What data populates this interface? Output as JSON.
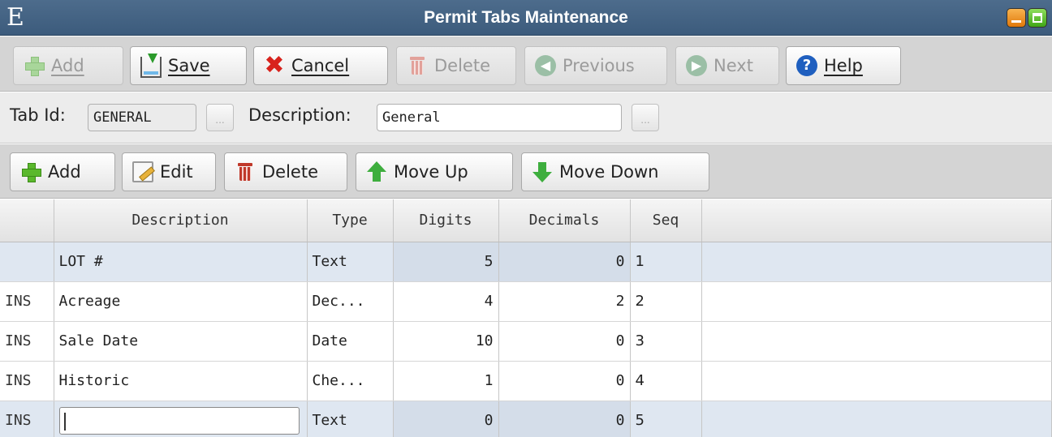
{
  "window": {
    "logo": "E",
    "title": "Permit Tabs Maintenance"
  },
  "toolbar": {
    "add": "Add",
    "save": "Save",
    "cancel": "Cancel",
    "delete": "Delete",
    "previous": "Previous",
    "next": "Next",
    "help": "Help"
  },
  "form": {
    "tab_id_label": "Tab Id:",
    "tab_id_value": "GENERAL",
    "description_label": "Description:",
    "description_value": "General",
    "ellipsis": "..."
  },
  "grid_toolbar": {
    "add": "Add",
    "edit": "Edit",
    "delete": "Delete",
    "move_up": "Move Up",
    "move_down": "Move Down"
  },
  "grid": {
    "columns": [
      "",
      "Description",
      "Type",
      "Digits",
      "Decimals",
      "Seq",
      ""
    ],
    "rows": [
      {
        "indicator": "",
        "description": "LOT #",
        "type": "Text",
        "digits": "5",
        "decimals": "0",
        "seq": "1"
      },
      {
        "indicator": "INS",
        "description": "Acreage",
        "type": "Dec...",
        "digits": "4",
        "decimals": "2",
        "seq": "2"
      },
      {
        "indicator": "INS",
        "description": "Sale Date",
        "type": "Date",
        "digits": "10",
        "decimals": "0",
        "seq": "3"
      },
      {
        "indicator": "INS",
        "description": "Historic",
        "type": "Che...",
        "digits": "1",
        "decimals": "0",
        "seq": "4"
      },
      {
        "indicator": "INS",
        "description": "",
        "type": "Text",
        "digits": "0",
        "decimals": "0",
        "seq": "5"
      }
    ]
  }
}
